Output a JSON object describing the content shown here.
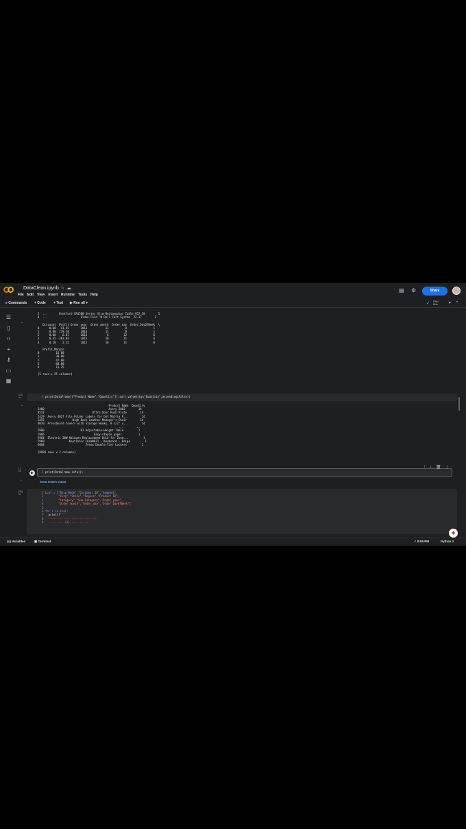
{
  "header": {
    "title": "DataClean.ipynb",
    "menu": [
      "File",
      "Edit",
      "View",
      "Insert",
      "Runtime",
      "Tools",
      "Help"
    ],
    "share_label": "Share"
  },
  "toolbar": {
    "commands_label": "Commands",
    "code_label": "+ Code",
    "text_label": "+ Text",
    "run_all_label": "Run all",
    "ram_label": "RAM",
    "disk_label": "Disk"
  },
  "output1": {
    "rows": "2  ...       Bretford CR4500 Series Slim Rectangular Table 957.58        5\n4  ...                    Eldon Fold 'N Roll Cart System  22.37        2\n\n   Discount  Profit Order_year  Order_month  Order_day  Order_DayOfWeek  \\\n0      0.00   41.91       2016           11          8                1\n1      0.00  219.58       2016           11          8                1\n2      0.00    6.87       2016            6         12                6\n3      0.45 -383.03       2015           10         11                6\n4      0.20    2.52       2015           10         11                6\n\n   Profit_Margin\n0          16.00\n1          30.00\n2          47.00\n3         -40.00\n4          11.25\n\n[5 rows x 25 columns]"
  },
  "cell2": {
    "exec_count": "[33]",
    "exec_time": "0s",
    "code": "print(DataFrame[[\"Product Name\",\"Quantity\"]].sort_values(by=\"Quantity\",ascending=False))"
  },
  "output2": {
    "rows": "                                           Product Name  Quantity\n5400                                       Avery 2002        14\n8521                             Ultra Door Push Plate        14\n1429  Avery 4027 File Folder Labels for Dot Matrix P...        14\n1455                 High Back Leather Manager's Chair        14\n8070  Pressboard Covers with Storage Hooks, 9 1/2\" x...        14\n...                                              ...       ...\n5980                      KI Adjustable-Height Table         1\n5966                              Easy-staple paper          1\n5964  Electrix 20W Halogen Replacement Bulb for Zoom...         1\n5960               Keytronic LKLW0021 - Keyboard - Beige         1\n6004                         Tenex Double-Tier Lockers         1\n\n[9994 rows x 2 columns]"
  },
  "cell3": {
    "exec_count": "[ ]",
    "exec_time": "0s",
    "code": "print(DataFrame.info())",
    "hidden_output_label": "Show hidden output"
  },
  "cell4": {
    "exec_count": "[35]",
    "exec_time": "0s",
    "lines": [
      "Lcol = [\"Ship Mode\",\"Customer ID\",\"Segment\",",
      "        \"City\",\"State\",\"Region\",\"Product ID\",",
      "        \"Category\",\"Sub-Category\",\"Order_year\",",
      "        \"Order_month\",\"Order_day\",\"Order_DayOfWeek\"]",
      "",
      "for i in Lcol:",
      "  print(f'''",
      "  ------------------------------",
      "  ----------{i}-----------"
    ]
  },
  "statusbar": {
    "variables_label": "Variables",
    "terminal_label": "Terminal",
    "time": "8:06 PM",
    "kernel": "Python 3"
  }
}
